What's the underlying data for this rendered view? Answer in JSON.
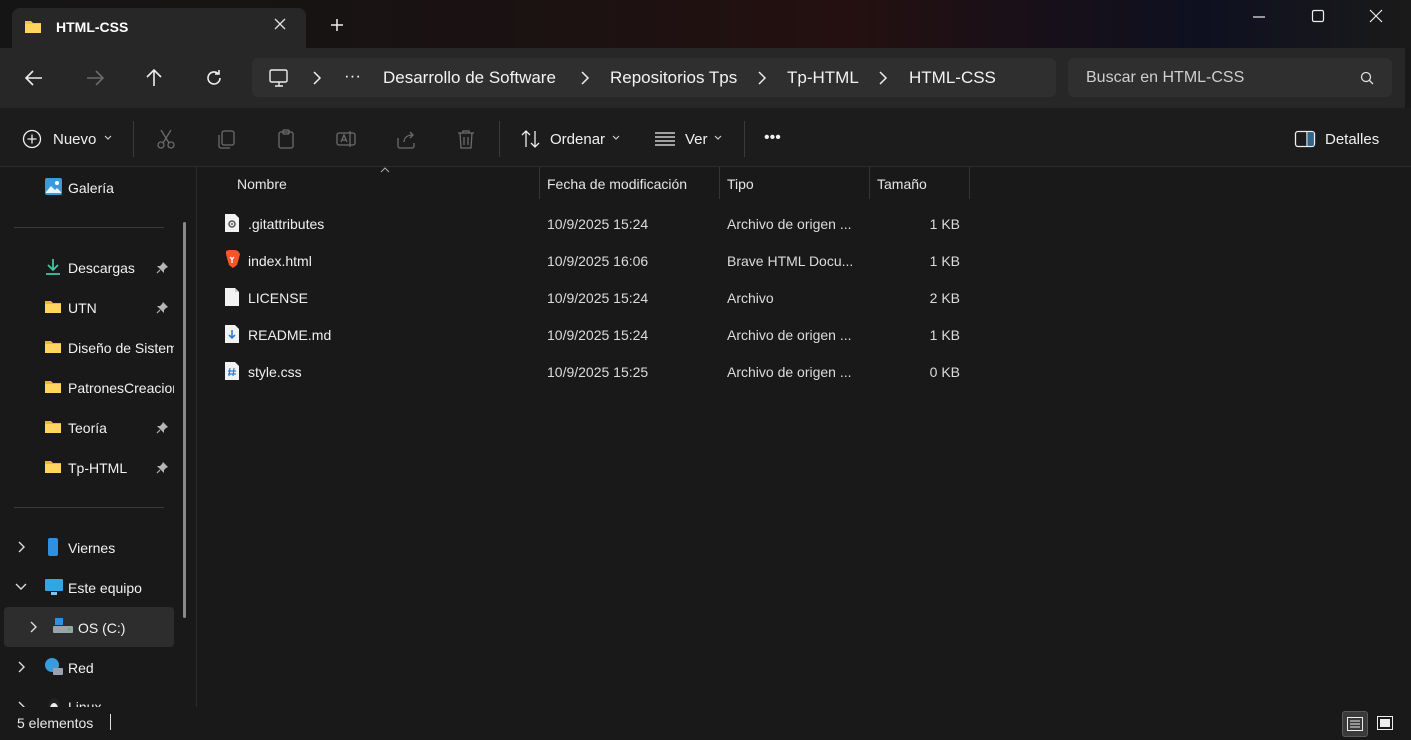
{
  "window": {
    "tab_title": "HTML-CSS",
    "folder-icon": "folder-icon"
  },
  "address": {
    "breadcrumbs": [
      "Desarrollo de Software",
      "Repositorios Tps",
      "Tp-HTML",
      "HTML-CSS"
    ],
    "overflow": "···",
    "search_placeholder": "Buscar en HTML-CSS"
  },
  "toolbar": {
    "new_label": "Nuevo",
    "sort_label": "Ordenar",
    "view_label": "Ver",
    "more_label": "•••",
    "details_label": "Detalles"
  },
  "nav": {
    "gallery": "Galería",
    "quick_access": [
      {
        "label": "Descargas",
        "pinned": true
      },
      {
        "label": "UTN",
        "pinned": true
      },
      {
        "label": "Diseño de Sistemas",
        "pinned": false
      },
      {
        "label": "PatronesCreacionales",
        "pinned": false
      },
      {
        "label": "Teoría",
        "pinned": true
      },
      {
        "label": "Tp-HTML",
        "pinned": true
      }
    ],
    "tree": [
      {
        "label": "Viernes"
      },
      {
        "label": "Este equipo"
      },
      {
        "label": "OS (C:)"
      },
      {
        "label": "Red"
      },
      {
        "label": "Linux"
      }
    ]
  },
  "columns": {
    "name": "Nombre",
    "modified": "Fecha de modificación",
    "type": "Tipo",
    "size": "Tamaño"
  },
  "files": [
    {
      "name": ".gitattributes",
      "modified": "10/9/2025 15:24",
      "type": "Archivo de origen ...",
      "size": "1 KB",
      "icon": "config-file-icon"
    },
    {
      "name": "index.html",
      "modified": "10/9/2025 16:06",
      "type": "Brave HTML Docu...",
      "size": "1 KB",
      "icon": "brave-html-icon"
    },
    {
      "name": "LICENSE",
      "modified": "10/9/2025 15:24",
      "type": "Archivo",
      "size": "2 KB",
      "icon": "blank-file-icon"
    },
    {
      "name": "README.md",
      "modified": "10/9/2025 15:24",
      "type": "Archivo de origen ...",
      "size": "1 KB",
      "icon": "markdown-file-icon"
    },
    {
      "name": "style.css",
      "modified": "10/9/2025 15:25",
      "type": "Archivo de origen ...",
      "size": "0 KB",
      "icon": "css-file-icon"
    }
  ],
  "status": {
    "count": "5 elementos"
  }
}
